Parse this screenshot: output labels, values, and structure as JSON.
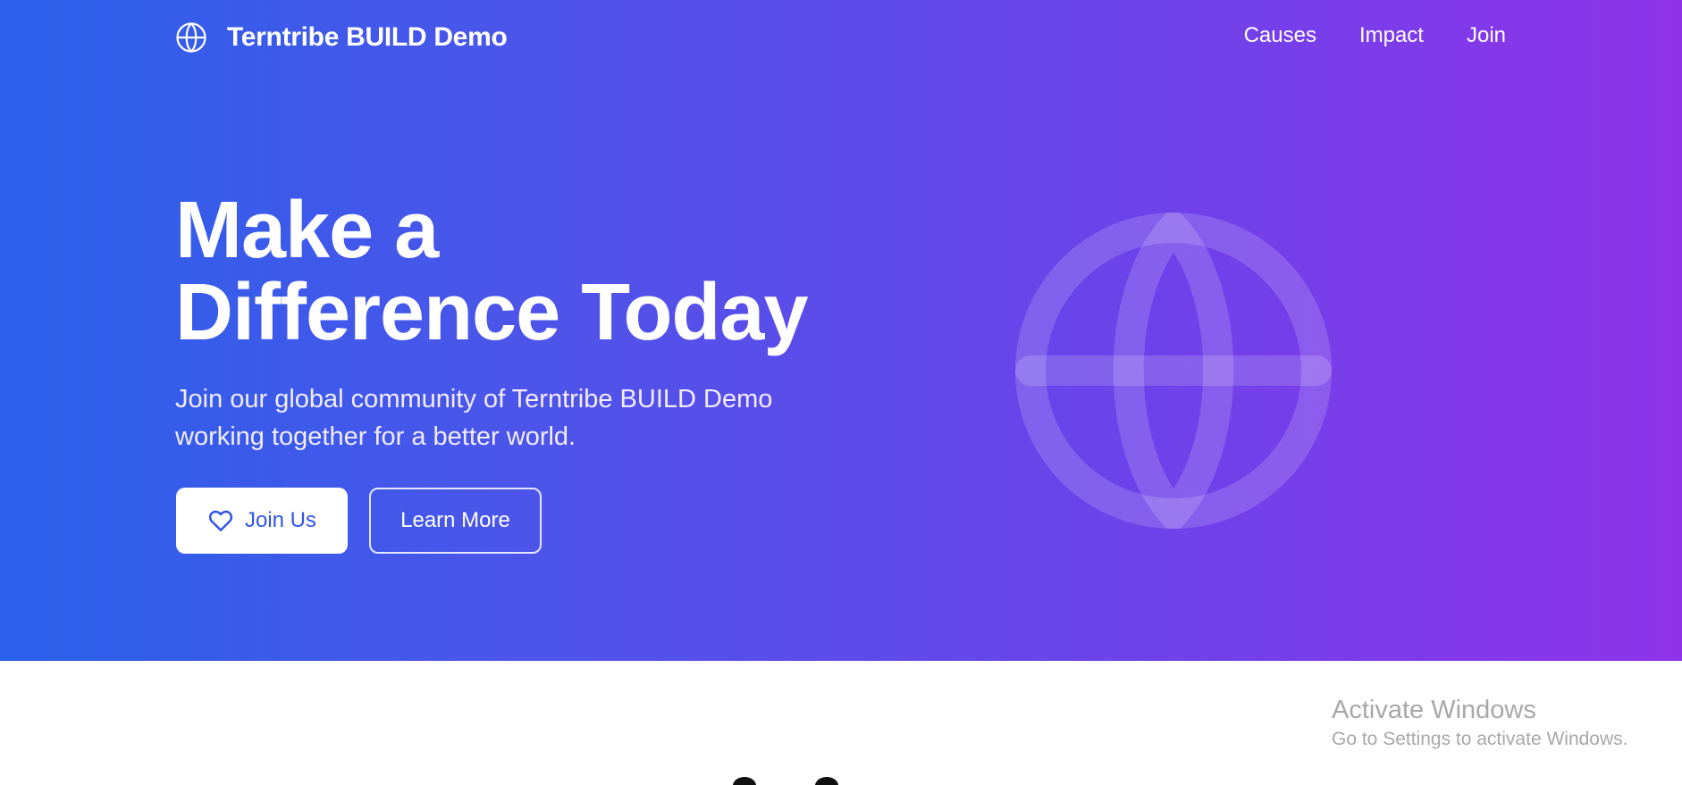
{
  "nav": {
    "brand_icon": "globe-icon",
    "brand_name": "Terntribe BUILD Demo",
    "links": [
      {
        "label": "Causes"
      },
      {
        "label": "Impact"
      },
      {
        "label": "Join"
      }
    ]
  },
  "hero": {
    "title_line1": "Make a",
    "title_line2": "Difference Today",
    "subtitle_line1": "Join our global community of Terntribe BUILD Demo",
    "subtitle_line2": "working together for a better world.",
    "primary_button": {
      "label": "Join Us",
      "icon": "heart-icon"
    },
    "secondary_button": {
      "label": "Learn More"
    },
    "illustration_icon": "globe-icon"
  },
  "watermark": {
    "title": "Activate Windows",
    "subtitle": "Go to Settings to activate Windows."
  },
  "colors": {
    "gradient_start": "#2a61ea",
    "gradient_end": "#8f33e9",
    "primary_text": "#2f55e6",
    "white": "#ffffff"
  }
}
